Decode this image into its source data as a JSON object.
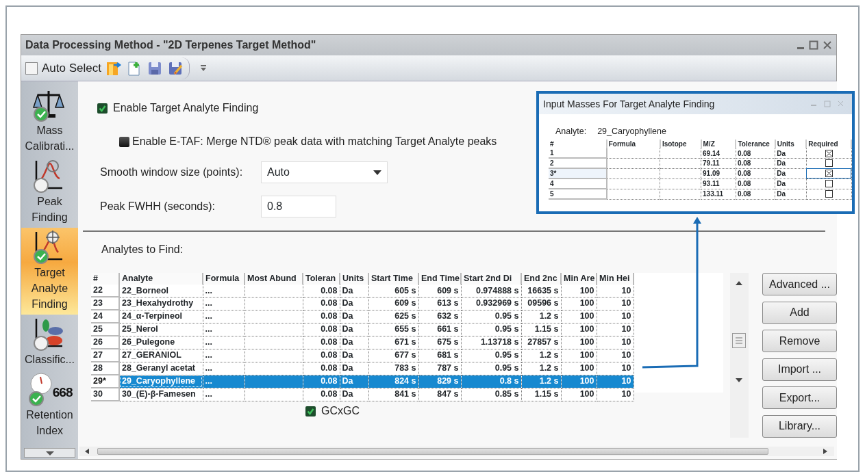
{
  "window": {
    "title": "Data Processing Method - \"2D Terpenes Target Method\""
  },
  "toolbar": {
    "auto_select": {
      "label": "Auto Select",
      "checked": false
    }
  },
  "sidebar": {
    "items": [
      {
        "label": "Mass Calibrati...",
        "kind": "balance",
        "validated": true,
        "selected": false
      },
      {
        "label": "Peak Finding",
        "kind": "peak",
        "validated": false,
        "selected": false
      },
      {
        "label": "Target Analyte Finding",
        "kind": "target",
        "validated": true,
        "selected": true
      },
      {
        "label": "Classific...",
        "kind": "classes",
        "validated": false,
        "selected": false
      },
      {
        "label": "Retention Index",
        "kind": "clock",
        "badge": "668",
        "validated": true,
        "selected": false
      }
    ]
  },
  "settings": {
    "enable_taf": {
      "label": "Enable Target Analyte Finding",
      "checked": true
    },
    "enable_etaf": {
      "label": "Enable E-TAF: Merge NTD® peak data with matching Target Analyte peaks",
      "checked": false
    },
    "smooth": {
      "label": "Smooth window size (points):",
      "value": "Auto"
    },
    "fwhh": {
      "label": "Peak FWHH (seconds):",
      "value": "0.8"
    }
  },
  "analytes": {
    "title": "Analytes to Find:",
    "columns": [
      "#",
      "Analyte",
      "Formula",
      "Most Abund",
      "Toleran",
      "Units",
      "Start Time",
      "End Time",
      "Start 2nd Di",
      "End 2nc",
      "Min Are",
      "Min Hei"
    ],
    "rows": [
      {
        "cells": [
          "22",
          "22_Borneol",
          "...",
          "",
          "0.08",
          "Da",
          "605 s",
          "609 s",
          "0.974888 s",
          "16635 s",
          "100",
          "10"
        ],
        "selected": false
      },
      {
        "cells": [
          "23",
          "23_Hexahydrothy",
          "...",
          "",
          "0.08",
          "Da",
          "609 s",
          "613 s",
          "0.932969 s",
          "09596 s",
          "100",
          "10"
        ],
        "selected": false
      },
      {
        "cells": [
          "24",
          "24_α-Terpineol",
          "...",
          "",
          "0.08",
          "Da",
          "625 s",
          "632 s",
          "0.95 s",
          "1.2 s",
          "100",
          "10"
        ],
        "selected": false
      },
      {
        "cells": [
          "25",
          "25_Nerol",
          "...",
          "",
          "0.08",
          "Da",
          "655 s",
          "661 s",
          "0.95 s",
          "1.15 s",
          "100",
          "10"
        ],
        "selected": false
      },
      {
        "cells": [
          "26",
          "26_Pulegone",
          "...",
          "",
          "0.08",
          "Da",
          "671 s",
          "675 s",
          "1.13718 s",
          "27857 s",
          "100",
          "10"
        ],
        "selected": false
      },
      {
        "cells": [
          "27",
          "27_GERANIOL",
          "...",
          "",
          "0.08",
          "Da",
          "677 s",
          "681 s",
          "0.95 s",
          "1.2 s",
          "100",
          "10"
        ],
        "selected": false
      },
      {
        "cells": [
          "28",
          "28_Geranyl acetat",
          "...",
          "",
          "0.08",
          "Da",
          "783 s",
          "787 s",
          "0.95 s",
          "1.2 s",
          "100",
          "10"
        ],
        "selected": false
      },
      {
        "cells": [
          "29*",
          "29_Caryophyllene",
          "...",
          "",
          "0.08",
          "Da",
          "824 s",
          "829 s",
          "0.8 s",
          "1.2 s",
          "100",
          "10"
        ],
        "selected": true
      },
      {
        "cells": [
          "30",
          "30_(E)-β-Famesen",
          "...",
          "",
          "0.08",
          "Da",
          "841 s",
          "847 s",
          "0.85 s",
          "1.15 s",
          "100",
          "10"
        ],
        "selected": false
      }
    ]
  },
  "gcxgc": {
    "label": "GCxGC",
    "checked": true
  },
  "buttons": [
    "Advanced ...",
    "Add",
    "Remove",
    "Import ...",
    "Export...",
    "Library..."
  ],
  "input_masses": {
    "title": "Input Masses For Target Analyte Finding",
    "analyte_label": "Analyte:",
    "analyte": "29_Caryophyllene",
    "columns": [
      "#",
      "Formula",
      "Isotope",
      "M/Z",
      "Tolerance",
      "Units",
      "Required"
    ],
    "rows": [
      {
        "n": "1",
        "mz": "69.14",
        "tolerance": "0.08",
        "units": "Da",
        "required": true,
        "selected": false
      },
      {
        "n": "2",
        "mz": "79.11",
        "tolerance": "0.08",
        "units": "Da",
        "required": false,
        "selected": false
      },
      {
        "n": "3*",
        "mz": "91.09",
        "tolerance": "0.08",
        "units": "Da",
        "required": true,
        "selected": true
      },
      {
        "n": "4",
        "mz": "93.11",
        "tolerance": "0.08",
        "units": "Da",
        "required": false,
        "selected": false
      },
      {
        "n": "5",
        "mz": "133.11",
        "tolerance": "0.08",
        "units": "Da",
        "required": false,
        "selected": false
      }
    ]
  }
}
